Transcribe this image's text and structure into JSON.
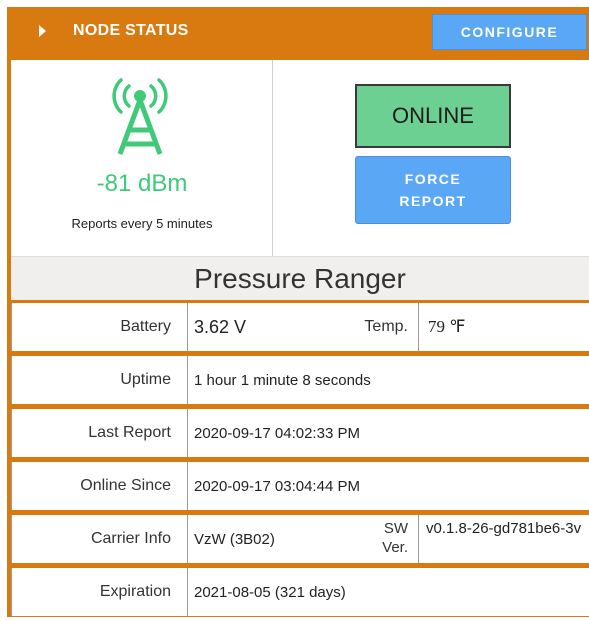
{
  "header": {
    "title": "NODE STATUS",
    "configure_label": "CONFIGURE"
  },
  "signal": {
    "icon": "cell-tower-icon",
    "strength": "-81 dBm",
    "report_interval": "Reports every 5 minutes"
  },
  "status": {
    "state": "ONLINE",
    "force_report_line1": "FORCE",
    "force_report_line2": "REPORT"
  },
  "device_name": "Pressure Ranger",
  "details": {
    "battery_label": "Battery",
    "battery_value": "3.62 V",
    "temp_label": "Temp.",
    "temp_value": "79 ℉",
    "uptime_label": "Uptime",
    "uptime_value": "1 hour 1 minute 8 seconds",
    "last_report_label": "Last Report",
    "last_report_value": "2020-09-17 04:02:33 PM",
    "online_since_label": "Online Since",
    "online_since_value": "2020-09-17 03:04:44 PM",
    "carrier_label": "Carrier Info",
    "carrier_value": "VzW (3B02)",
    "sw_label_line1": "SW",
    "sw_label_line2": "Ver.",
    "sw_value": "v0.1.8-26-gd781be6-3v",
    "expiration_label": "Expiration",
    "expiration_value": "2021-08-05 (321 days)"
  },
  "colors": {
    "accent_orange": "#d97a10",
    "button_blue": "#5aa8f5",
    "online_green": "#6cd093",
    "signal_green": "#3fc979"
  }
}
